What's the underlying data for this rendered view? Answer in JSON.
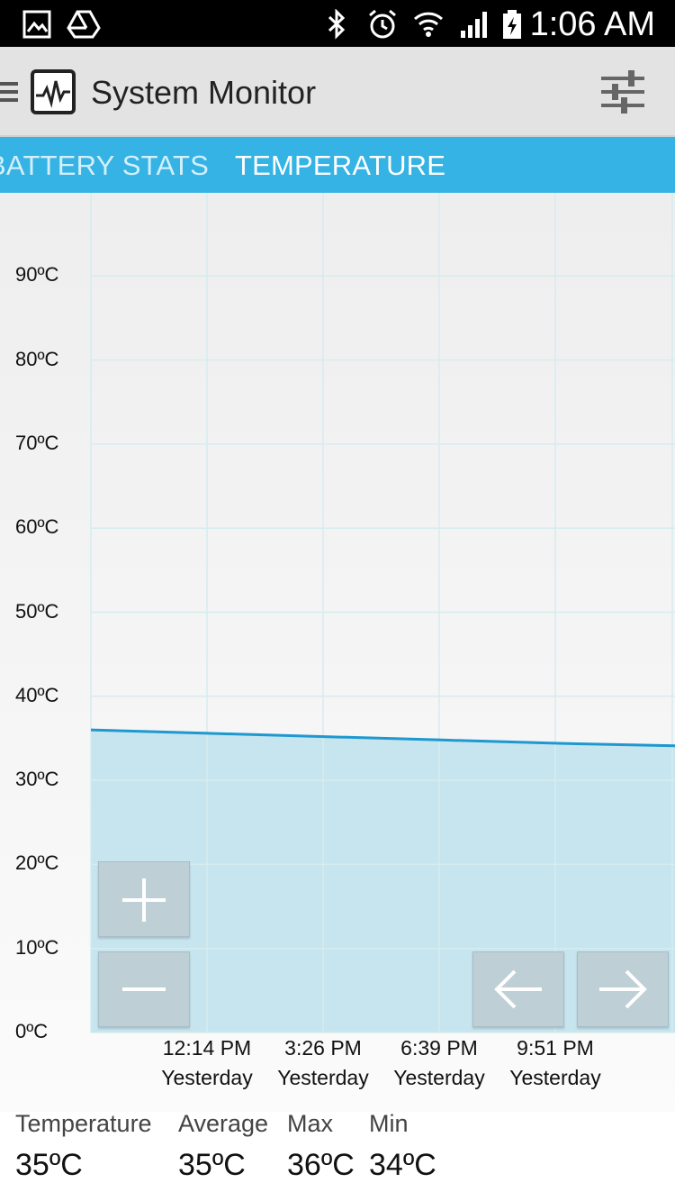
{
  "status_bar": {
    "time": "1:06 AM",
    "left_icons": [
      "gallery-icon",
      "drive-icon"
    ],
    "right_icons": [
      "bluetooth-icon",
      "alarm-icon",
      "wifi-icon",
      "signal-icon",
      "battery-icon"
    ]
  },
  "app_bar": {
    "title": "System Monitor",
    "icons": [
      "menu-icon",
      "pulse-logo-icon",
      "sliders-icon"
    ]
  },
  "tabs": [
    {
      "label": "BATTERY STATS",
      "active": false
    },
    {
      "label": "TEMPERATURE",
      "active": true
    }
  ],
  "colors": {
    "accent": "#34b3e4",
    "line": "#1e98cf",
    "fill": "#c6e5ef"
  },
  "chart_data": {
    "type": "area",
    "y_tick_labels": [
      "0ºC",
      "10ºC",
      "20ºC",
      "30ºC",
      "40ºC",
      "50ºC",
      "60ºC",
      "70ºC",
      "80ºC",
      "90ºC"
    ],
    "y_ticks": [
      0,
      10,
      20,
      30,
      40,
      50,
      60,
      70,
      80,
      90
    ],
    "ylim": [
      0,
      100
    ],
    "x_tick_labels": [
      {
        "time": "12:14 PM",
        "day": "Yesterday"
      },
      {
        "time": "3:26 PM",
        "day": "Yesterday"
      },
      {
        "time": "6:39 PM",
        "day": "Yesterday"
      },
      {
        "time": "9:51 PM",
        "day": "Yesterday"
      }
    ],
    "series": [
      {
        "values": [
          36,
          35.6,
          35.2,
          34.8,
          34.4,
          34.1
        ]
      }
    ],
    "grid": true
  },
  "controls": {
    "zoom_in": "plus-icon",
    "zoom_out": "minus-icon",
    "pan_left": "arrow-left-icon",
    "pan_right": "arrow-right-icon"
  },
  "stats": {
    "temperature": {
      "label": "Temperature",
      "value": "35ºC"
    },
    "average": {
      "label": "Average",
      "value": "35ºC"
    },
    "max": {
      "label": "Max",
      "value": "36ºC"
    },
    "min": {
      "label": "Min",
      "value": "34ºC"
    }
  }
}
